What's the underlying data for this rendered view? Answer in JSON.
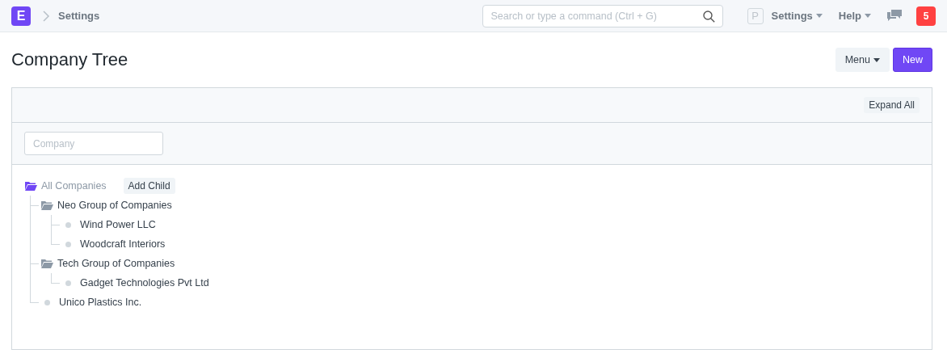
{
  "navbar": {
    "logo": "E",
    "breadcrumb": "Settings",
    "search": {
      "placeholder": "Search or type a command (Ctrl + G)"
    },
    "avatar": "P",
    "menus": [
      "Settings",
      "Help"
    ],
    "notification_count": "5"
  },
  "page": {
    "title": "Company Tree",
    "buttons": [
      {
        "label": "Menu",
        "kind": "dropdown"
      },
      {
        "label": "New",
        "kind": "primary"
      }
    ]
  },
  "toolbar": {
    "expand_all": "Expand All"
  },
  "filter": {
    "placeholder": "Company"
  },
  "tree": {
    "label": "All Companies",
    "kind": "group",
    "selected": true,
    "action": "Add Child",
    "children": [
      {
        "label": "Neo Group of Companies",
        "kind": "group",
        "selected": false,
        "children": [
          {
            "label": "Wind Power LLC",
            "kind": "leaf",
            "selected": false
          },
          {
            "label": "Woodcraft Interiors",
            "kind": "leaf",
            "selected": false
          }
        ]
      },
      {
        "label": "Tech Group of Companies",
        "kind": "group",
        "selected": false,
        "children": [
          {
            "label": "Gadget Technologies Pvt Ltd",
            "kind": "leaf",
            "selected": false
          }
        ]
      },
      {
        "label": "Unico Plastics Inc.",
        "kind": "leaf",
        "selected": false
      }
    ]
  }
}
